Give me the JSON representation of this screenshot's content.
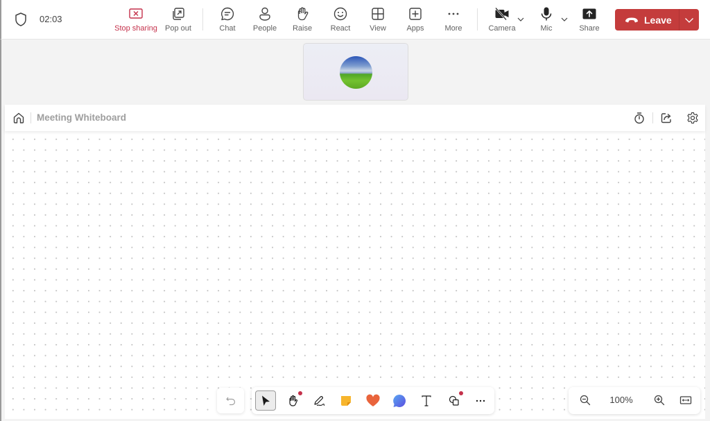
{
  "meeting": {
    "timer": "02:03",
    "toolbar": [
      {
        "id": "stop-sharing",
        "label": "Stop sharing",
        "icon": "stop-share-icon"
      },
      {
        "id": "pop-out",
        "label": "Pop out",
        "icon": "pop-out-icon"
      },
      {
        "id": "chat",
        "label": "Chat",
        "icon": "chat-icon"
      },
      {
        "id": "people",
        "label": "People",
        "icon": "people-icon"
      },
      {
        "id": "raise",
        "label": "Raise",
        "icon": "raise-hand-icon"
      },
      {
        "id": "react",
        "label": "React",
        "icon": "smiley-icon"
      },
      {
        "id": "view",
        "label": "View",
        "icon": "grid-view-icon"
      },
      {
        "id": "apps",
        "label": "Apps",
        "icon": "add-app-icon"
      },
      {
        "id": "more",
        "label": "More",
        "icon": "more-icon"
      },
      {
        "id": "camera",
        "label": "Camera",
        "icon": "camera-off-icon"
      },
      {
        "id": "mic",
        "label": "Mic",
        "icon": "mic-icon"
      },
      {
        "id": "share",
        "label": "Share",
        "icon": "share-tray-icon"
      }
    ],
    "leave_label": "Leave",
    "colors": {
      "leave": "#c43c3c",
      "stop_sharing": "#c4314b"
    }
  },
  "whiteboard": {
    "title": "Meeting Whiteboard",
    "zoom_level": "100%",
    "tools": [
      {
        "id": "select",
        "icon": "select-arrow-icon",
        "active": true
      },
      {
        "id": "pan",
        "icon": "hand-icon",
        "badge": true
      },
      {
        "id": "pen",
        "icon": "pen-icon"
      },
      {
        "id": "sticky-note",
        "icon": "sticky-note-icon"
      },
      {
        "id": "reactions",
        "icon": "heart-icon"
      },
      {
        "id": "comment",
        "icon": "comment-bubble-icon"
      },
      {
        "id": "text",
        "icon": "text-icon"
      },
      {
        "id": "shapes",
        "icon": "shapes-icon",
        "badge": true
      },
      {
        "id": "more",
        "icon": "more-icon"
      }
    ]
  }
}
